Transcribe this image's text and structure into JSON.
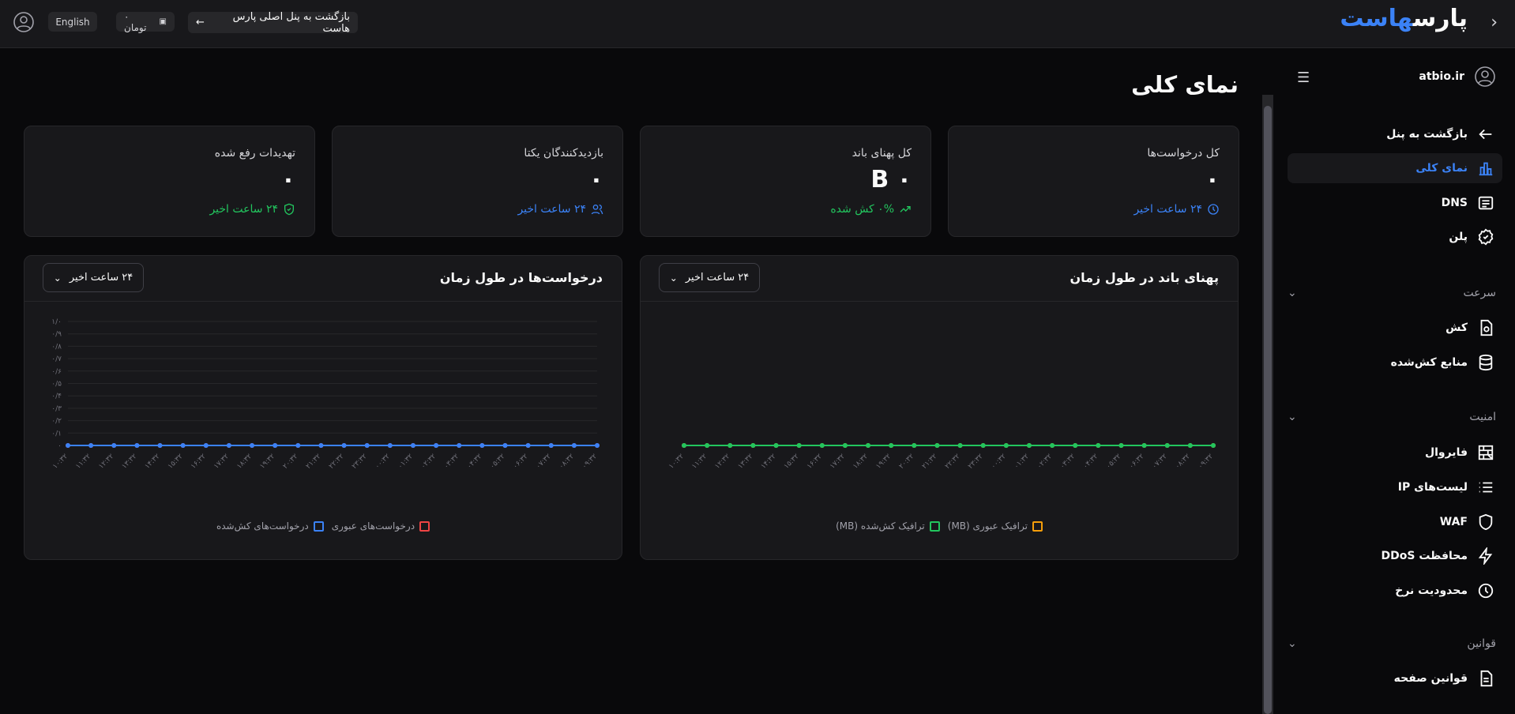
{
  "topbar": {
    "logo_text_1": "پارس",
    "logo_text_2": "هاست",
    "back_button": "بازگشت به پنل اصلی پارس هاست",
    "balance": "۰ تومان",
    "language": "English"
  },
  "sidebar": {
    "user": "atbio.ir",
    "back": "بازگشت به پنل",
    "items": [
      {
        "label": "نمای کلی",
        "icon": "chart-bar-icon",
        "active": true
      },
      {
        "label": "DNS",
        "icon": "dns-list-icon"
      },
      {
        "label": "پلن",
        "icon": "badge-icon"
      }
    ],
    "sections": [
      {
        "label": "سرعت",
        "items": [
          {
            "label": "کش",
            "icon": "cache-file-icon"
          },
          {
            "label": "منابع کش‌شده",
            "icon": "database-icon"
          }
        ]
      },
      {
        "label": "امنیت",
        "items": [
          {
            "label": "فایروال",
            "icon": "firewall-icon"
          },
          {
            "label": "لیست‌های IP",
            "icon": "list-icon"
          },
          {
            "label": "WAF",
            "icon": "shield-icon"
          },
          {
            "label": "محافظت DDoS",
            "icon": "lightning-icon"
          },
          {
            "label": "محدودیت نرخ",
            "icon": "clock-icon"
          }
        ]
      },
      {
        "label": "قوانین",
        "items": [
          {
            "label": "قوانین صفحه",
            "icon": "document-icon"
          }
        ]
      }
    ]
  },
  "page": {
    "title": "نمای کلی"
  },
  "cards": [
    {
      "label": "کل درخواست‌ها",
      "value": "۰",
      "foot": "۲۴ ساعت اخیر",
      "foot_color": "#3b82f6"
    },
    {
      "label": "کل پهنای باند",
      "value": "۰ B",
      "foot": "۰% کش شده",
      "foot_color": "#22c55e"
    },
    {
      "label": "بازدیدکنندگان یکتا",
      "value": "۰",
      "foot": "۲۴ ساعت اخیر",
      "foot_color": "#3b82f6"
    },
    {
      "label": "تهدیدات رفع شده",
      "value": "۰",
      "foot": "۲۴ ساعت اخیر",
      "foot_color": "#22c55e"
    }
  ],
  "panels": {
    "bandwidth": {
      "title": "پهنای باند در طول زمان",
      "select": "۲۴ ساعت اخیر"
    },
    "requests": {
      "title": "درخواست‌ها در طول زمان",
      "select": "۲۴ ساعت اخیر"
    }
  },
  "chart_data": [
    {
      "type": "line",
      "title": "پهنای باند در طول زمان",
      "x": [
        "۱۰:۳۲",
        "۱۱:۳۲",
        "۱۲:۳۲",
        "۱۳:۳۲",
        "۱۴:۳۲",
        "۱۵:۳۲",
        "۱۶:۳۲",
        "۱۷:۳۲",
        "۱۸:۳۲",
        "۱۹:۳۲",
        "۲۰:۳۲",
        "۲۱:۳۲",
        "۲۲:۳۲",
        "۲۳:۳۲",
        "۰۰:۳۲",
        "۰۱:۳۲",
        "۰۲:۳۲",
        "۰۳:۳۲",
        "۰۴:۳۲",
        "۰۵:۳۲",
        "۰۶:۳۲",
        "۰۷:۳۲",
        "۰۸:۳۲",
        "۰۹:۳۲"
      ],
      "series": [
        {
          "name": "ترافیک عبوری (MB)",
          "color": "#f59e0b",
          "values": [
            0,
            0,
            0,
            0,
            0,
            0,
            0,
            0,
            0,
            0,
            0,
            0,
            0,
            0,
            0,
            0,
            0,
            0,
            0,
            0,
            0,
            0,
            0,
            0
          ]
        },
        {
          "name": "ترافیک کش‌شده (MB)",
          "color": "#22c55e",
          "values": [
            0,
            0,
            0,
            0,
            0,
            0,
            0,
            0,
            0,
            0,
            0,
            0,
            0,
            0,
            0,
            0,
            0,
            0,
            0,
            0,
            0,
            0,
            0,
            0
          ]
        }
      ],
      "grid": false
    },
    {
      "type": "line",
      "title": "درخواست‌ها در طول زمان",
      "x": [
        "۱۰:۳۲",
        "۱۱:۳۲",
        "۱۲:۳۲",
        "۱۳:۳۲",
        "۱۴:۳۲",
        "۱۵:۳۲",
        "۱۶:۳۲",
        "۱۷:۳۲",
        "۱۸:۳۲",
        "۱۹:۳۲",
        "۲۰:۳۲",
        "۲۱:۳۲",
        "۲۲:۳۲",
        "۲۳:۳۲",
        "۰۰:۳۲",
        "۰۱:۳۲",
        "۰۲:۳۲",
        "۰۳:۳۲",
        "۰۴:۳۲",
        "۰۵:۳۲",
        "۰۶:۳۲",
        "۰۷:۳۲",
        "۰۸:۳۲",
        "۰۹:۳۲"
      ],
      "yticks": [
        "۰",
        "۰/۱",
        "۰/۲",
        "۰/۳",
        "۰/۴",
        "۰/۵",
        "۰/۶",
        "۰/۷",
        "۰/۸",
        "۰/۹",
        "۱/۰"
      ],
      "ylim": [
        0,
        1
      ],
      "series": [
        {
          "name": "درخواست‌های عبوری",
          "color": "#ef4444",
          "values": [
            0,
            0,
            0,
            0,
            0,
            0,
            0,
            0,
            0,
            0,
            0,
            0,
            0,
            0,
            0,
            0,
            0,
            0,
            0,
            0,
            0,
            0,
            0,
            0
          ]
        },
        {
          "name": "درخواست‌های کش‌شده",
          "color": "#3b82f6",
          "values": [
            0,
            0,
            0,
            0,
            0,
            0,
            0,
            0,
            0,
            0,
            0,
            0,
            0,
            0,
            0,
            0,
            0,
            0,
            0,
            0,
            0,
            0,
            0,
            0
          ]
        }
      ],
      "grid": true
    }
  ]
}
